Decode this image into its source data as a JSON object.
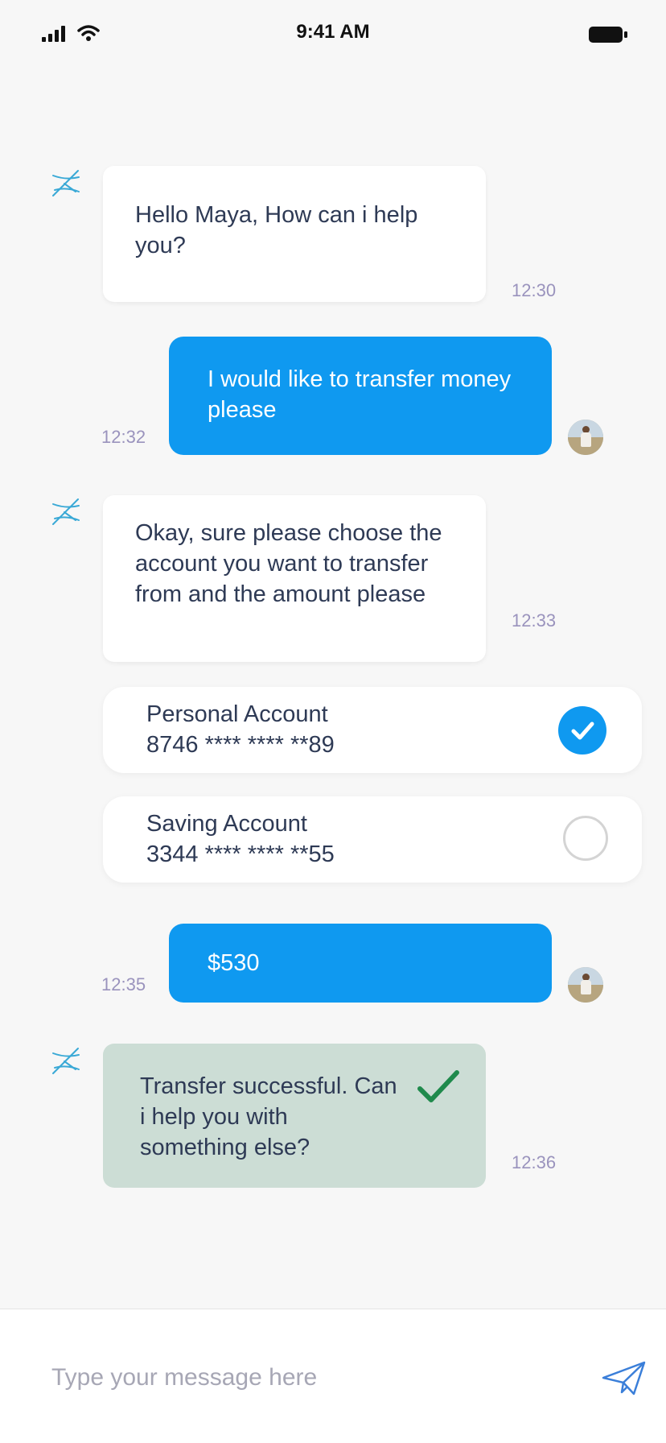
{
  "status_bar": {
    "time": "9:41 AM"
  },
  "messages": [
    {
      "from": "bot",
      "text": "Hello Maya, How can i help you?",
      "time": "12:30"
    },
    {
      "from": "user",
      "text": "I would like to transfer money please",
      "time": "12:32"
    },
    {
      "from": "bot",
      "text": "Okay, sure please choose the account you want to transfer from and the amount please",
      "time": "12:33"
    },
    {
      "from": "user",
      "text": "$530",
      "time": "12:35"
    },
    {
      "from": "bot",
      "text": "Transfer successful. Can i help you with something else?",
      "time": "12:36",
      "status": "success"
    }
  ],
  "accounts": [
    {
      "name": "Personal Account",
      "number": "8746 **** **** **89",
      "selected": true
    },
    {
      "name": "Saving Account",
      "number": "3344 **** **** **55",
      "selected": false
    }
  ],
  "composer": {
    "placeholder": "Type your message here"
  },
  "colors": {
    "accent": "#0f99f0",
    "background": "#f7f7f7",
    "success_bubble": "#ccddd5",
    "success_check": "#1f8a4c",
    "timestamp": "#9a93bd",
    "text": "#2e3a55"
  },
  "icons": {
    "bot": "bot-logo-icon",
    "send": "paper-plane-icon",
    "selected": "checkmark-icon",
    "success": "checkmark-icon"
  }
}
